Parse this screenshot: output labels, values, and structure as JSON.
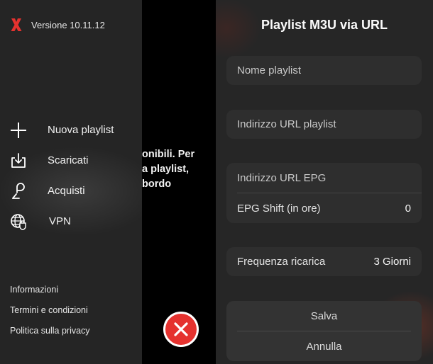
{
  "drawer": {
    "version": "Versione 10.11.12",
    "menu": [
      {
        "label": "Nuova playlist",
        "icon": "plus-icon"
      },
      {
        "label": "Scaricati",
        "icon": "download-tray-icon"
      },
      {
        "label": "Acquisti",
        "icon": "purchase-icon"
      },
      {
        "label": "VPN",
        "icon": "globe-shield-icon"
      }
    ],
    "footer": [
      "Informazioni",
      "Termini e condizioni",
      "Politica sulla privacy"
    ]
  },
  "background": {
    "lines": [
      "onibili. Per",
      "a playlist,",
      "bordo"
    ]
  },
  "panel": {
    "title": "Playlist M3U via URL",
    "name_placeholder": "Nome playlist",
    "url_placeholder": "Indirizzo URL playlist",
    "epg_placeholder": "Indirizzo URL EPG",
    "epg_shift_label": "EPG Shift (in ore)",
    "epg_shift_value": "0",
    "reload_label": "Frequenza ricarica",
    "reload_value": "3 Giorni",
    "save": "Salva",
    "cancel": "Annulla"
  },
  "colors": {
    "accent": "#e5322f",
    "panel": "#262626",
    "field": "#2e2e2e"
  }
}
